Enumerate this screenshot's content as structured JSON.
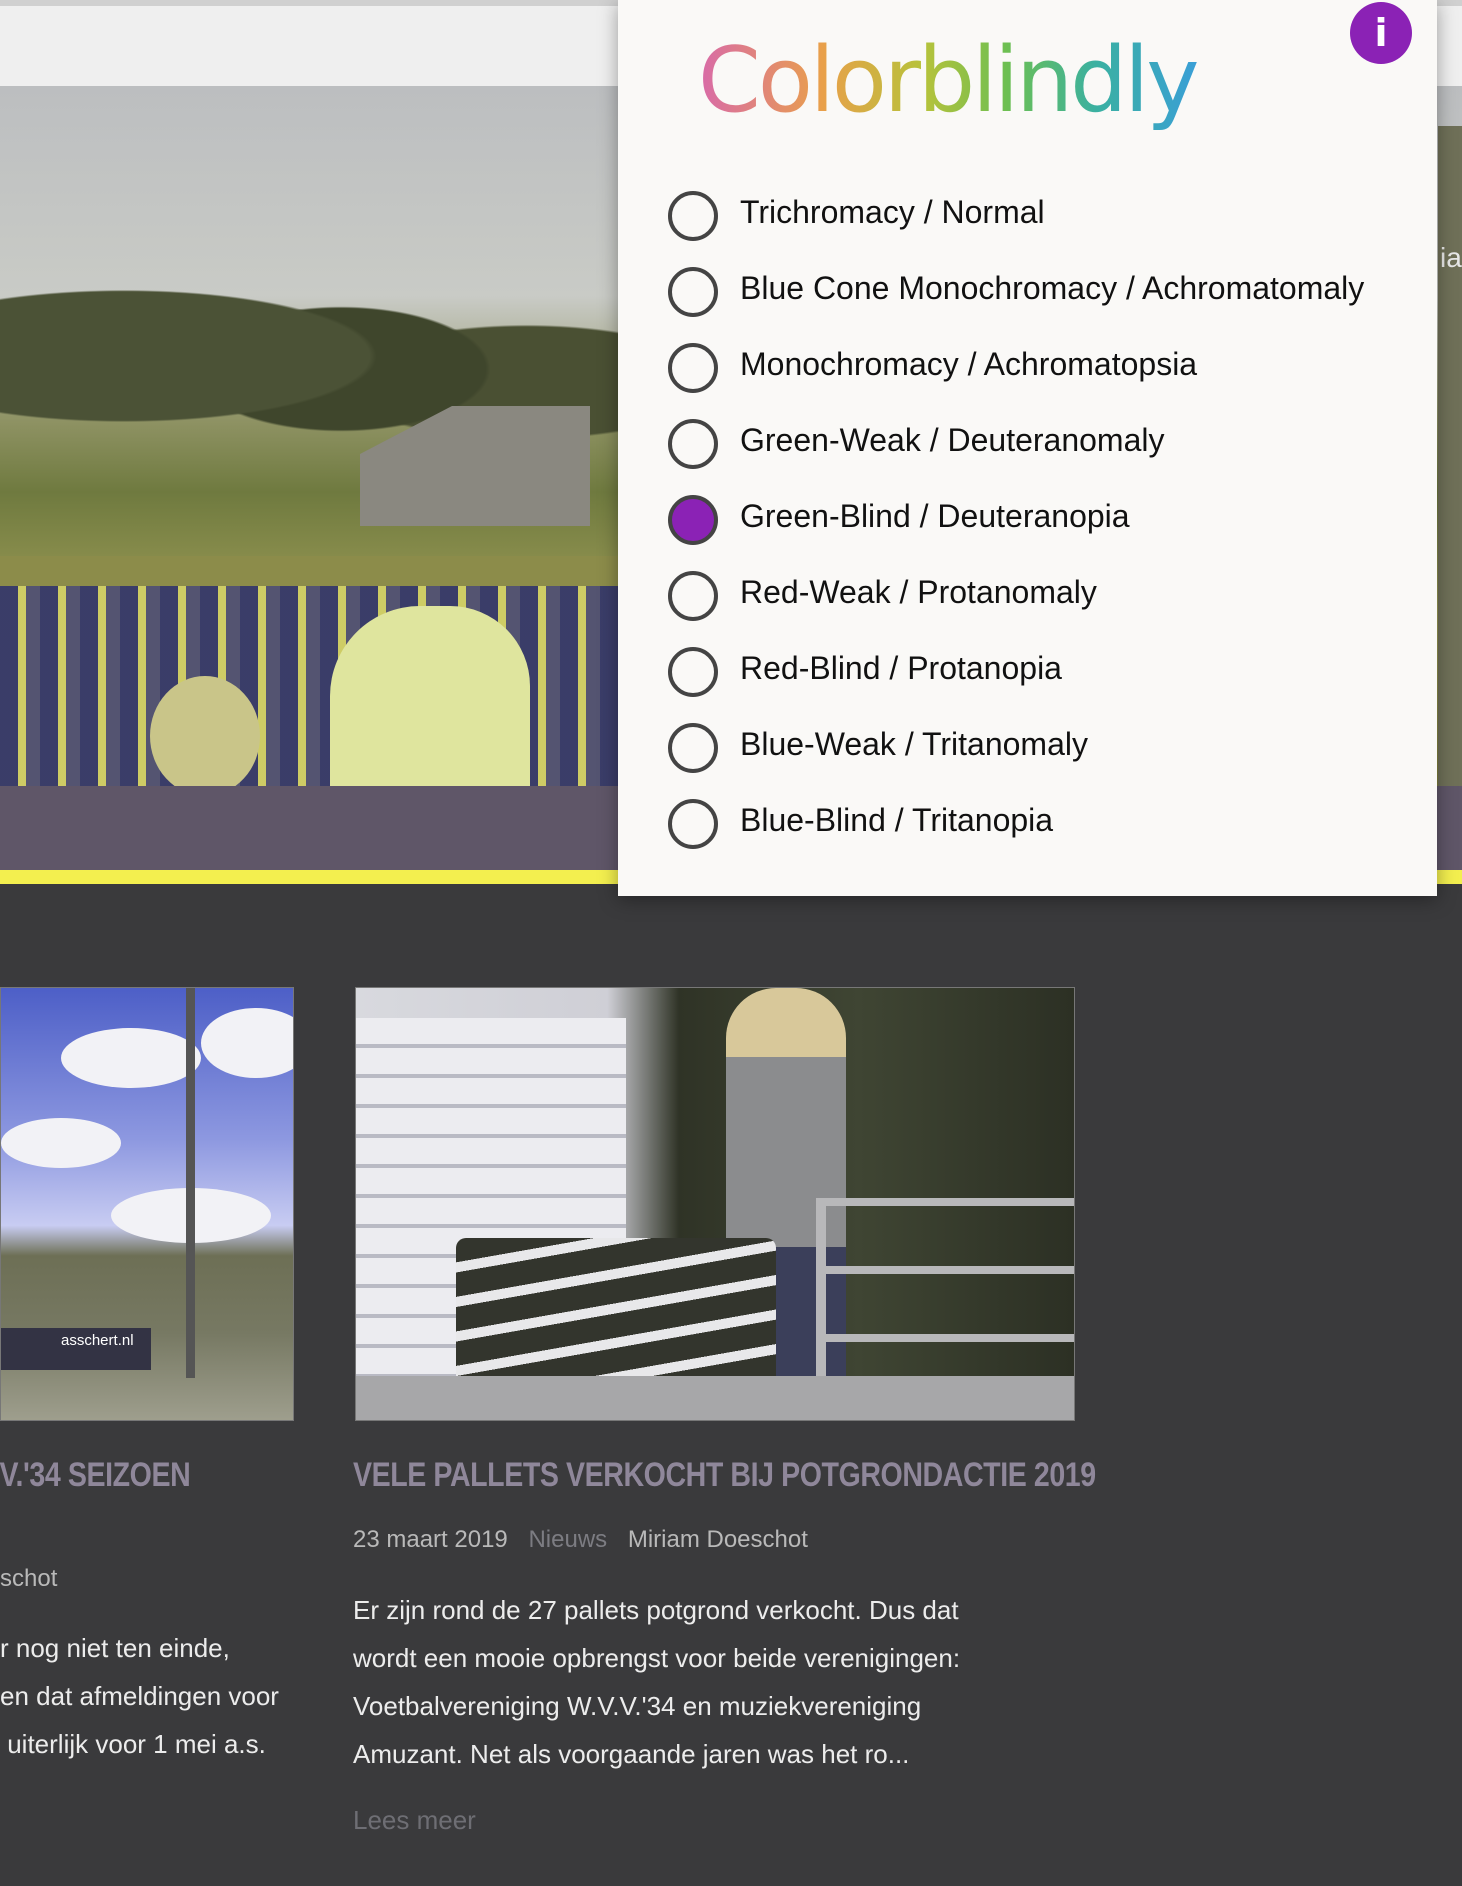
{
  "popup": {
    "title": "Colorblindly",
    "info_label": "i",
    "accent_color": "#8b22b5",
    "options": [
      {
        "label": "Trichromacy / Normal",
        "checked": false
      },
      {
        "label": "Blue Cone Monochromacy / Achromatomaly",
        "checked": false
      },
      {
        "label": "Monochromacy / Achromatopsia",
        "checked": false
      },
      {
        "label": "Green-Weak / Deuteranomaly",
        "checked": false
      },
      {
        "label": "Green-Blind / Deuteranopia",
        "checked": true
      },
      {
        "label": "Red-Weak / Protanomaly",
        "checked": false
      },
      {
        "label": "Red-Blind / Protanopia",
        "checked": false
      },
      {
        "label": "Blue-Weak / Tritanomaly",
        "checked": false
      },
      {
        "label": "Blue-Blind / Tritanopia",
        "checked": false
      }
    ]
  },
  "hero": {
    "cutoff_text": "ia"
  },
  "articles": [
    {
      "title": ".V.'34 SEIZOEN",
      "author": "schot",
      "excerpt_lines": [
        "r nog niet ten einde,",
        "en dat afmeldingen voor",
        " uiterlijk voor 1 mei a.s."
      ],
      "image_text": "asschert.nl"
    },
    {
      "title": "VELE PALLETS VERKOCHT BIJ POTGRONDACTIE 2019",
      "date": "23 maart 2019",
      "category": "Nieuws",
      "author": "Miriam Doeschot",
      "excerpt_lines": [
        "Er zijn rond de 27 pallets potgrond verkocht. Dus dat",
        "wordt een mooie opbrengst voor beide verenigingen:",
        "Voetbalvereniging W.V.V.'34 en muziekvereniging",
        "Amuzant. Net als voorgaande jaren was het ro..."
      ],
      "read_more": "Lees meer"
    }
  ],
  "colors": {
    "page_background": "#3a3a3c",
    "purple_band": "#5f5668",
    "yellow_line": "#f3ef4f",
    "title_color": "#8f879a"
  }
}
